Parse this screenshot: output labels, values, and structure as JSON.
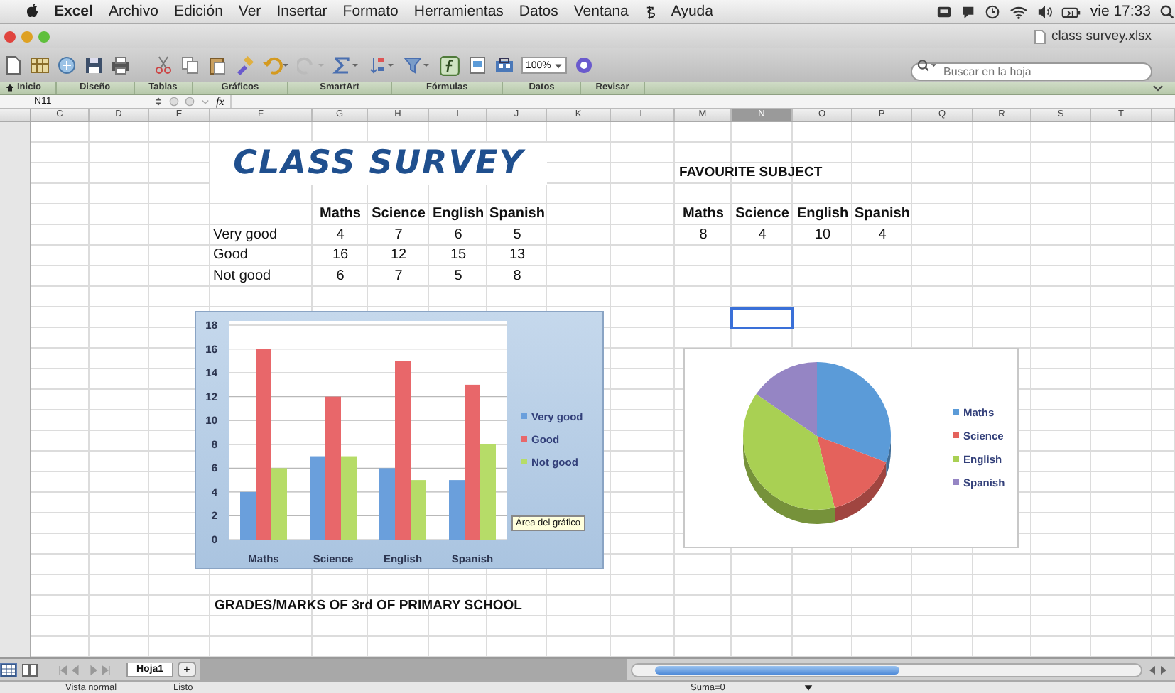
{
  "menu_bar": {
    "app": "Excel",
    "items": [
      "Archivo",
      "Edición",
      "Ver",
      "Insertar",
      "Formato",
      "Herramientas",
      "Datos",
      "Ventana",
      "Ayuda"
    ],
    "clock": "vie 17:33"
  },
  "window": {
    "title": "class survey.xlsx"
  },
  "toolbar": {
    "zoom": "100%",
    "search": {
      "placeholder": "Buscar en la hoja"
    }
  },
  "ribbon_tabs": [
    {
      "label": "Inicio",
      "selected": false
    },
    {
      "label": "Diseño",
      "selected": false
    },
    {
      "label": "Tablas",
      "selected": false
    },
    {
      "label": "Gráficos",
      "selected": false
    },
    {
      "label": "SmartArt",
      "selected": false
    },
    {
      "label": "Fórmulas",
      "selected": false
    },
    {
      "label": "Datos",
      "selected": false
    },
    {
      "label": "Revisar",
      "selected": false
    }
  ],
  "formula_bar": {
    "name_box": "N11",
    "fx": "fx"
  },
  "columns": [
    {
      "label": "C",
      "selected": false
    },
    {
      "label": "D",
      "selected": false
    },
    {
      "label": "E",
      "selected": false
    },
    {
      "label": "F",
      "selected": false
    },
    {
      "label": "G",
      "selected": false
    },
    {
      "label": "H",
      "selected": false
    },
    {
      "label": "I",
      "selected": false
    },
    {
      "label": "J",
      "selected": false
    },
    {
      "label": "K",
      "selected": false
    },
    {
      "label": "L",
      "selected": false
    },
    {
      "label": "M",
      "selected": false
    },
    {
      "label": "N",
      "selected": true
    },
    {
      "label": "O",
      "selected": false
    },
    {
      "label": "P",
      "selected": false
    },
    {
      "label": "Q",
      "selected": false
    },
    {
      "label": "R",
      "selected": false
    },
    {
      "label": "S",
      "selected": false
    },
    {
      "label": "T",
      "selected": false
    }
  ],
  "survey": {
    "title": "CLASS SURVEY",
    "columns": [
      "Maths",
      "Science",
      "English",
      "Spanish"
    ],
    "rows": [
      {
        "label": "Very good",
        "values": [
          "4",
          "7",
          "6",
          "5"
        ]
      },
      {
        "label": "Good",
        "values": [
          "16",
          "12",
          "15",
          "13"
        ]
      },
      {
        "label": "Not good",
        "values": [
          "6",
          "7",
          "5",
          "8"
        ]
      }
    ]
  },
  "favourite": {
    "title": "FAVOURITE SUBJECT",
    "columns": [
      "Maths",
      "Science",
      "English",
      "Spanish"
    ],
    "values": [
      "8",
      "4",
      "10",
      "4"
    ]
  },
  "bar_chart": {
    "chart_data": {
      "type": "bar",
      "categories": [
        "Maths",
        "Science",
        "English",
        "Spanish"
      ],
      "series": [
        {
          "name": "Very good",
          "color": "#6a9fdc",
          "values": [
            4,
            7,
            6,
            5
          ]
        },
        {
          "name": "Good",
          "color": "#e8676a",
          "values": [
            16,
            12,
            15,
            13
          ]
        },
        {
          "name": "Not good",
          "color": "#b6dc68",
          "values": [
            6,
            7,
            5,
            8
          ]
        }
      ],
      "ylim": [
        0,
        18
      ],
      "yticks": [
        0,
        2,
        4,
        6,
        8,
        10,
        12,
        14,
        16,
        18
      ],
      "grid": true,
      "legend": true
    },
    "tooltip": "Área del gráfico"
  },
  "pie_chart": {
    "chart_data": {
      "type": "pie",
      "categories": [
        "Maths",
        "Science",
        "English",
        "Spanish"
      ],
      "values": [
        30.77,
        15.38,
        38.47,
        15.38
      ],
      "legend": true,
      "colors": [
        "#5b9bd8",
        "#e4625c",
        "#a9d053",
        "#9585c4"
      ]
    }
  },
  "caption": "GRADES/MARKS OF 3rd OF PRIMARY SCHOOL",
  "sheet_tabs": [
    {
      "label": "Hoja1",
      "selected": true
    }
  ],
  "add_sheet": "+",
  "status_bar": {
    "view": "Vista normal",
    "status": "Listo",
    "sum": "Suma=0"
  }
}
